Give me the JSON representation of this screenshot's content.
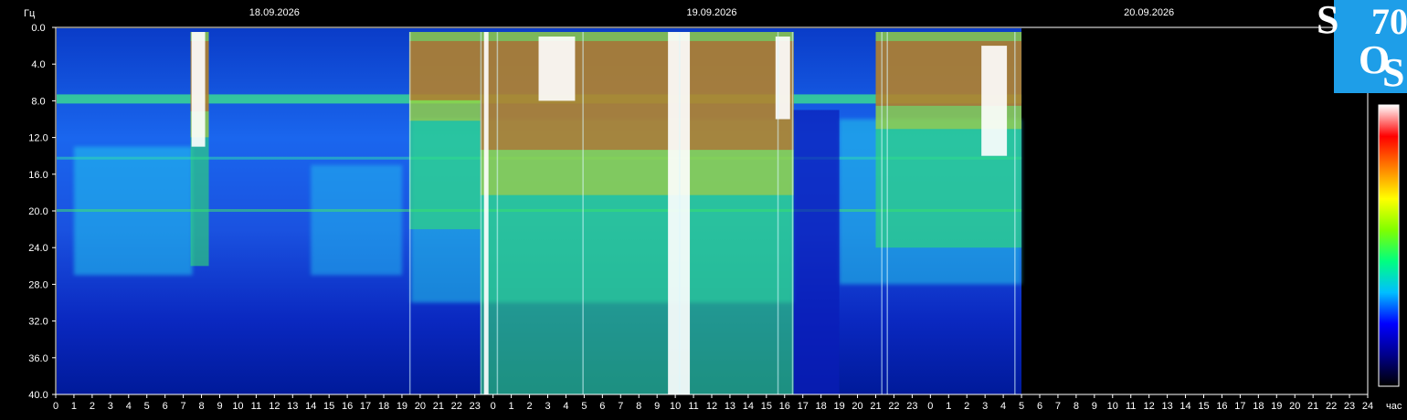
{
  "chart_data": {
    "type": "heatmap",
    "title": "",
    "ylabel": "Гц",
    "xlabel": "час",
    "ylim": [
      0,
      40
    ],
    "y_ticks": [
      "0.0",
      "4.0",
      "8.0",
      "12.0",
      "16.0",
      "20.0",
      "24.0",
      "28.0",
      "32.0",
      "36.0",
      "40.0"
    ],
    "y_inverted": true,
    "x_range_hours": [
      0,
      72
    ],
    "x_ticks": [
      "0",
      "1",
      "2",
      "3",
      "4",
      "5",
      "6",
      "7",
      "8",
      "9",
      "10",
      "11",
      "12",
      "13",
      "14",
      "15",
      "16",
      "17",
      "18",
      "19",
      "20",
      "21",
      "22",
      "23",
      "0",
      "1",
      "2",
      "3",
      "4",
      "5",
      "6",
      "7",
      "8",
      "9",
      "10",
      "11",
      "12",
      "13",
      "14",
      "15",
      "16",
      "17",
      "18",
      "19",
      "20",
      "21",
      "22",
      "23",
      "0",
      "1",
      "2",
      "3",
      "4",
      "5",
      "6",
      "7",
      "8",
      "9",
      "10",
      "11",
      "12",
      "13",
      "14",
      "15",
      "16",
      "17",
      "18",
      "19",
      "20",
      "21",
      "22",
      "23",
      "24"
    ],
    "dates": [
      {
        "label": "18.09.2026",
        "hour": 12
      },
      {
        "label": "19.09.2026",
        "hour": 36
      },
      {
        "label": "20.09.2026",
        "hour": 60
      }
    ],
    "data_end_hour": 53.0,
    "resonance_bands_hz": [
      7.8,
      14.3,
      20.0
    ],
    "intense_periods": [
      {
        "start_hour": 7.4,
        "end_hour": 8.4,
        "max_hz": 26
      },
      {
        "start_hour": 19.4,
        "end_hour": 23.3,
        "max_hz": 22
      },
      {
        "start_hour": 23.3,
        "end_hour": 40.5,
        "max_hz": 40
      },
      {
        "start_hour": 45.0,
        "end_hour": 53.0,
        "max_hz": 24
      }
    ],
    "colorbar": [
      "#000000",
      "#00008b",
      "#0000ff",
      "#00bfff",
      "#00ff80",
      "#80ff00",
      "#ffff00",
      "#ff8000",
      "#ff0000",
      "#ffffff"
    ],
    "colors": {
      "background": "#000000",
      "axis": "#ffffff",
      "logo_bg": "#1e9ee8"
    }
  },
  "logo": {
    "letters": [
      "S",
      "O",
      "S",
      "70"
    ]
  }
}
